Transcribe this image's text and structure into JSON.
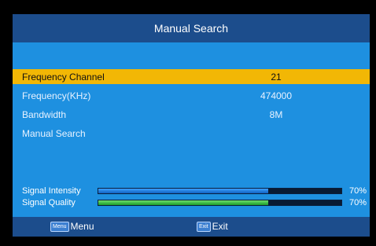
{
  "header": {
    "title": "Manual Search"
  },
  "menu": {
    "items": [
      {
        "label": "Frequency Channel",
        "value": "21",
        "selected": true
      },
      {
        "label": "Frequency(KHz)",
        "value": "474000",
        "selected": false
      },
      {
        "label": "Bandwidth",
        "value": "8M",
        "selected": false
      },
      {
        "label": "Manual Search",
        "value": "",
        "selected": false
      }
    ]
  },
  "signal": {
    "intensity": {
      "label": "Signal Intensity",
      "percent_text": "70%",
      "level": 0.7
    },
    "quality": {
      "label": "Signal Quality",
      "percent_text": "70%",
      "level": 0.7
    }
  },
  "footer": {
    "menu": {
      "key_text": "Menu",
      "label": "Menu",
      "icon": "menu-key-icon"
    },
    "exit": {
      "key_text": "Exit",
      "label": "Exit",
      "icon": "exit-key-icon"
    }
  },
  "colors": {
    "background": "#1e90e0",
    "header_bar": "#1c4d8c",
    "highlight": "#f2b705",
    "intensity_bar": "#1a74d9",
    "quality_bar": "#2fbf3a"
  }
}
